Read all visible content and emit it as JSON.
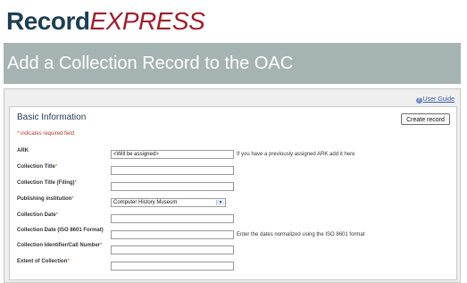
{
  "logo": {
    "part1": "Record",
    "part2": "EXPRESS"
  },
  "page_title": "Add a Collection Record to the OAC",
  "user_guide": {
    "label": "User Guide",
    "icon": "help-icon"
  },
  "section": {
    "title": "Basic Information",
    "create_button": "Create record",
    "required_note": "* indicates required field"
  },
  "fields": [
    {
      "label": "ARK",
      "required": "",
      "value": "<Will be assigned>",
      "hint": "If you have a previously assigned ARK add it here"
    },
    {
      "label": "Collection Title",
      "required": "*",
      "value": "",
      "hint": ""
    },
    {
      "label": "Collection Title (Filing)",
      "required": "*",
      "value": "",
      "hint": ""
    },
    {
      "label": "Publishing institution",
      "required": "*",
      "value": "Computer History Museum",
      "hint": ""
    },
    {
      "label": "Collection Date",
      "required": "*",
      "value": "",
      "hint": ""
    },
    {
      "label": "Collection Date (ISO 8601 Format)",
      "required": "",
      "value": "",
      "hint": "Enter the dates normalized using the ISO 8601 format"
    },
    {
      "label": "Collection Identifier/Call Number",
      "required": "*",
      "value": "",
      "hint": ""
    },
    {
      "label": "Extent of Collection",
      "required": "*",
      "value": "",
      "hint": ""
    }
  ],
  "colors": {
    "brand_dark": "#1d3f52",
    "brand_red": "#a01e2b",
    "banner": "#a6b3b3",
    "required": "#c0392b",
    "link": "#3a5ba8"
  }
}
